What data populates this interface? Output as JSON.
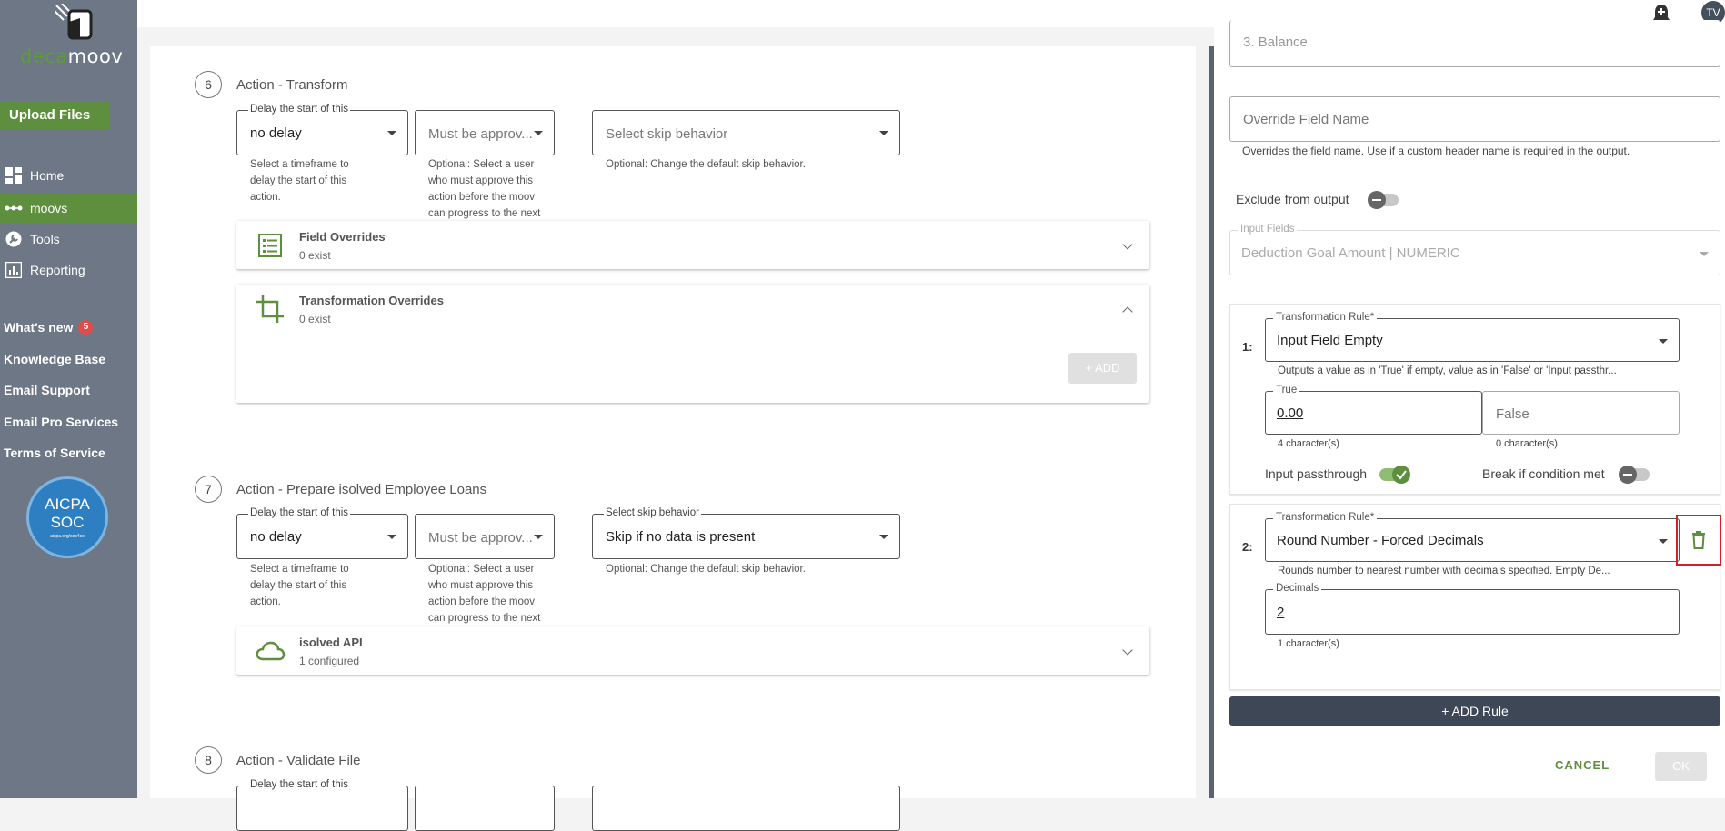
{
  "sidebar": {
    "brand_prefix": "deca",
    "brand_suffix": "moov",
    "upload_label": "Upload Files",
    "nav": [
      {
        "label": "Home",
        "icon": "dashboard-icon"
      },
      {
        "label": "moovs",
        "icon": "moovs-dots-icon"
      },
      {
        "label": "Tools",
        "icon": "wrench-icon"
      },
      {
        "label": "Reporting",
        "icon": "chart-icon"
      }
    ],
    "links": {
      "whats_new": "What's new",
      "whats_new_count": "5",
      "knowledge_base": "Knowledge Base",
      "email_support": "Email Support",
      "email_pro": "Email Pro Services",
      "terms": "Terms of Service"
    },
    "soc_badge": {
      "line1": "AICPA",
      "line2": "SOC",
      "line3": "aicpa.org/soc4so"
    }
  },
  "topbar": {
    "avatar_initials": "TV"
  },
  "steps": [
    {
      "number": "6",
      "title": "Action - Transform",
      "delay_label": "Delay the start of this",
      "delay_value": "no delay",
      "delay_help": [
        "Select a timeframe to",
        "delay the start of this",
        "action."
      ],
      "approver_placeholder": "Must be approv...",
      "approver_help": [
        "Optional: Select a user",
        "who must approve this",
        "action before the moov",
        "can progress to the next"
      ],
      "skip_label": "",
      "skip_value": "Select skip behavior",
      "skip_help": "Optional: Change the default skip behavior.",
      "cards": [
        {
          "title": "Field Overrides",
          "sub": "0 exist"
        },
        {
          "title": "Transformation Overrides",
          "sub": "0 exist"
        }
      ],
      "add_label": "+ ADD"
    },
    {
      "number": "7",
      "title": "Action - Prepare isolved Employee Loans",
      "delay_label": "Delay the start of this",
      "delay_value": "no delay",
      "delay_help": [
        "Select a timeframe to",
        "delay the start of this",
        "action."
      ],
      "approver_placeholder": "Must be approv...",
      "approver_help": [
        "Optional: Select a user",
        "who must approve this",
        "action before the moov",
        "can progress to the next"
      ],
      "skip_label": "Select skip behavior",
      "skip_value": "Skip if no data is present",
      "skip_help": "Optional: Change the default skip behavior.",
      "cards": [
        {
          "title": "isolved API",
          "sub": "1 configured"
        }
      ]
    },
    {
      "number": "8",
      "title": "Action - Validate File",
      "delay_label": "Delay the start of this"
    }
  ],
  "right": {
    "top_partial_value": "3. Balance",
    "override_placeholder": "Override Field Name",
    "override_help": "Overrides the field name. Use if a custom header name is required in the output.",
    "exclude_label": "Exclude from output",
    "input_fields_label": "Input Fields",
    "input_fields_value": "Deduction Goal Amount | NUMERIC",
    "rules": [
      {
        "number": "1:",
        "rule_label": "Transformation Rule*",
        "rule_value": "Input Field Empty",
        "rule_help": "Outputs a value as in 'True' if empty, value as in 'False' or 'Input passthr...",
        "true_label": "True",
        "true_value": "0.00",
        "true_count": "4 character(s)",
        "false_placeholder": "False",
        "false_count": "0 character(s)",
        "passthrough_label": "Input passthrough",
        "passthrough_on": true,
        "break_label": "Break if condition met",
        "break_on": false
      },
      {
        "number": "2:",
        "rule_label": "Transformation Rule*",
        "rule_value": "Round Number - Forced Decimals",
        "rule_help": "Rounds number to nearest number with decimals specified. Empty De...",
        "decimals_label": "Decimals",
        "decimals_value": "2",
        "decimals_count": "1 character(s)"
      }
    ],
    "add_rule_label": "+ ADD Rule",
    "cancel_label": "CANCEL",
    "ok_label": "OK"
  },
  "colors": {
    "accent_green": "#5d8f3f",
    "sidebar": "#6d7785",
    "danger": "#d1202a",
    "dark_button": "#3d4756"
  }
}
